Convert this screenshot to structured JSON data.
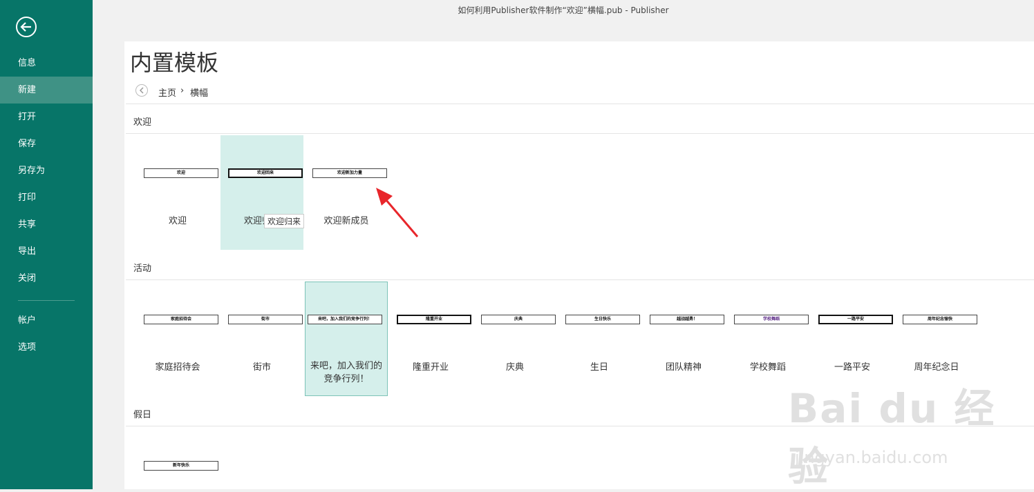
{
  "window": {
    "title": "如何利用Publisher软件制作“欢迎”横幅.pub - Publisher"
  },
  "sidebar": {
    "items": [
      {
        "label": "信息"
      },
      {
        "label": "新建"
      },
      {
        "label": "打开"
      },
      {
        "label": "保存"
      },
      {
        "label": "另存为"
      },
      {
        "label": "打印"
      },
      {
        "label": "共享"
      },
      {
        "label": "导出"
      },
      {
        "label": "关闭"
      },
      {
        "label": "帐户"
      },
      {
        "label": "选项"
      }
    ],
    "active": "新建"
  },
  "page": {
    "title": "内置模板"
  },
  "breadcrumb": {
    "home": "主页",
    "separator": "›",
    "current": "横幅"
  },
  "sections": [
    {
      "name": "欢迎",
      "items": [
        {
          "label": "欢迎",
          "thumb": "欢迎"
        },
        {
          "label": "欢迎归来",
          "thumb": "欢迎回来"
        },
        {
          "label": "欢迎新成员",
          "thumb": "欢迎新加力量"
        }
      ]
    },
    {
      "name": "活动",
      "items": [
        {
          "label": "家庭招待会",
          "thumb": "家庭招待会"
        },
        {
          "label": "街市",
          "thumb": "街市"
        },
        {
          "label": "来吧，加入我们的竞争行列！",
          "label_line1": "来吧，加入我们的",
          "label_line2": "竞争行列！",
          "thumb": "来吧，加入我们的竞争行列！"
        },
        {
          "label": "隆重开业",
          "thumb": "隆重开业"
        },
        {
          "label": "庆典",
          "thumb": "庆典"
        },
        {
          "label": "生日",
          "thumb": "生日快乐"
        },
        {
          "label": "团队精神",
          "thumb": "越战越勇！"
        },
        {
          "label": "学校舞蹈",
          "thumb": "学校舞蹈"
        },
        {
          "label": "一路平安",
          "thumb": "一路平安"
        },
        {
          "label": "周年纪念日",
          "thumb": "周年纪念愉快"
        }
      ]
    },
    {
      "name": "假日",
      "items": [
        {
          "label": "新年快乐",
          "thumb": "新年快乐"
        }
      ]
    }
  ],
  "tooltip": {
    "text": "欢迎归来"
  },
  "watermark": {
    "brand": "Bai du 经验",
    "url": "jingyan.baidu.com"
  },
  "colors": {
    "sidebar": "#077568",
    "active": "#3f9285",
    "selection": "#d5efeb",
    "arrow": "#e8262b"
  }
}
